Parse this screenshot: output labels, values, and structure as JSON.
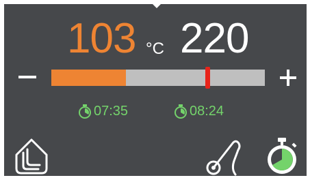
{
  "display": {
    "current_temp": "103",
    "unit": "°C",
    "target_temp": "220"
  },
  "controls": {
    "minus_icon": "minus-icon",
    "plus_icon": "plus-icon"
  },
  "temperature_bar": {
    "fill_fraction": 0.35,
    "marker_fraction": 0.73,
    "fill_color": "#ee8433",
    "track_color": "#bfbfbf",
    "marker_color": "#e8241a"
  },
  "timers": [
    {
      "icon": "timer-icon",
      "value": "07:35"
    },
    {
      "icon": "timer-icon",
      "value": "08:24"
    }
  ],
  "bottom_bar": {
    "left_icon": "program-icon",
    "probe_icon": "meat-probe-icon",
    "stopwatch_icon": "stopwatch-icon"
  },
  "colors": {
    "background": "#46484b",
    "current_temp": "#ee8433",
    "timer_text": "#74d36b",
    "stopwatch_active": "#74d36b"
  }
}
